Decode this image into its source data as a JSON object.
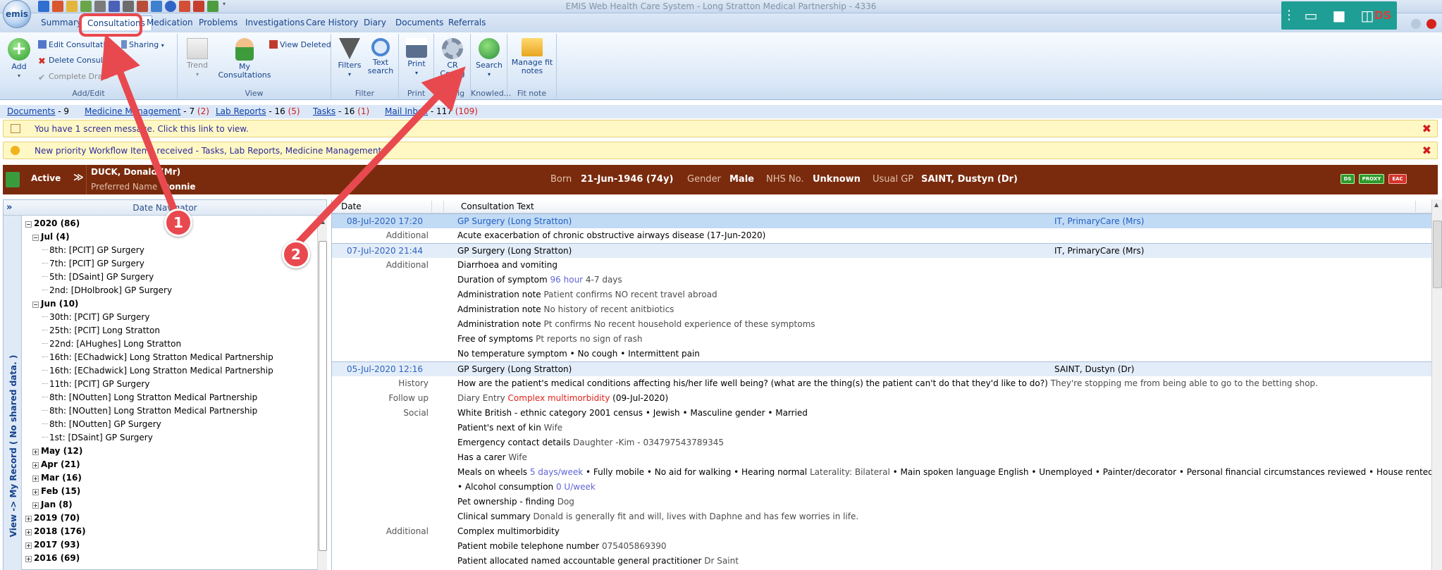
{
  "window": {
    "title": "EMIS Web Health Care System - Long Stratton Medical Partnership - 4336",
    "orb_label": "emis"
  },
  "tabs": [
    "Summary",
    "Consultations",
    "Medication",
    "Problems",
    "Investigations",
    "Care History",
    "Diary",
    "Documents",
    "Referrals"
  ],
  "active_tab": "Consultations",
  "teal_toolbar": {
    "initials": "DS"
  },
  "ribbon": {
    "add": "Add",
    "edit_consultation": "Edit Consultation",
    "sharing": "Sharing",
    "delete_consultation": "Delete Consultation",
    "complete_draft": "Complete Draft",
    "group_add_edit": "Add/Edit",
    "trend": "Trend",
    "my_consultations": "My Consultations",
    "view_deleted": "View Deleted",
    "group_view": "View",
    "filters": "Filters",
    "text_search": "Text search",
    "group_filter": "Filter",
    "print": "Print",
    "group_print": "Print",
    "cr_config": "CR Config",
    "group_config": "Config",
    "search": "Search",
    "group_knowledge": "Knowled...",
    "manage_fit_notes": "Manage fit notes",
    "group_fit_note": "Fit note"
  },
  "links": {
    "documents": "Documents",
    "documents_count": " - 9",
    "medicine": "Medicine Management",
    "medicine_count": " - 7 ",
    "medicine_red": "(2)",
    "lab": "Lab Reports",
    "lab_count": " - 16 ",
    "lab_red": "(5)",
    "tasks": "Tasks",
    "tasks_count": " - 16 ",
    "tasks_red": "(1)",
    "mail": "Mail Inbox",
    "mail_count": " - 117 ",
    "mail_red": "(109)"
  },
  "notifications": {
    "message": "You have 1 screen message. Click this link to view.",
    "priority": "New priority Workflow Items received - Tasks, Lab Reports, Medicine Management"
  },
  "patient": {
    "status": "Active",
    "name": "DUCK, Donald (Mr)",
    "preferred_label": "Preferred Name",
    "preferred_name": "Donnie",
    "born_label": "Born",
    "born": "21-Jun-1946 (74y)",
    "gender_label": "Gender",
    "gender": "Male",
    "nhs_label": "NHS No.",
    "nhs": "Unknown",
    "gp_label": "Usual GP",
    "gp": "SAINT, Dustyn (Dr)",
    "flags": [
      "DS",
      "PROXY",
      "EAC"
    ]
  },
  "navigator": {
    "header": "Date Navigator",
    "expand": "»",
    "vertical_text": "View -> My Record ( No shared data. )",
    "items": [
      {
        "text": "2020 (86)",
        "level": 0,
        "bold": true,
        "sign": "−"
      },
      {
        "text": "Jul (4)",
        "level": 1,
        "bold": true,
        "sign": "−"
      },
      {
        "text": "8th: [PCIT] GP Surgery",
        "level": 2
      },
      {
        "text": "7th: [PCIT] GP Surgery",
        "level": 2
      },
      {
        "text": "5th: [DSaint] GP Surgery",
        "level": 2
      },
      {
        "text": "2nd: [DHolbrook] GP Surgery",
        "level": 2
      },
      {
        "text": "Jun (10)",
        "level": 1,
        "bold": true,
        "sign": "−"
      },
      {
        "text": "30th: [PCIT] GP Surgery",
        "level": 2
      },
      {
        "text": "25th: [PCIT] Long Stratton",
        "level": 2
      },
      {
        "text": "22nd: [AHughes] Long Stratton",
        "level": 2
      },
      {
        "text": "16th: [EChadwick] Long Stratton Medical Partnership",
        "level": 2
      },
      {
        "text": "16th: [EChadwick] Long Stratton Medical Partnership",
        "level": 2
      },
      {
        "text": "11th: [PCIT] GP Surgery",
        "level": 2
      },
      {
        "text": "8th: [NOutten] Long Stratton Medical Partnership",
        "level": 2
      },
      {
        "text": "8th: [NOutten] Long Stratton Medical Partnership",
        "level": 2
      },
      {
        "text": "8th: [NOutten] GP Surgery",
        "level": 2
      },
      {
        "text": "1st: [DSaint] GP Surgery",
        "level": 2
      },
      {
        "text": "May (12)",
        "level": 1,
        "bold": true,
        "sign": "+"
      },
      {
        "text": "Apr (21)",
        "level": 1,
        "bold": true,
        "sign": "+"
      },
      {
        "text": "Mar (16)",
        "level": 1,
        "bold": true,
        "sign": "+"
      },
      {
        "text": "Feb (15)",
        "level": 1,
        "bold": true,
        "sign": "+"
      },
      {
        "text": "Jan (8)",
        "level": 1,
        "bold": true,
        "sign": "+"
      },
      {
        "text": "2019 (70)",
        "level": 0,
        "bold": true,
        "sign": "+"
      },
      {
        "text": "2018 (176)",
        "level": 0,
        "bold": true,
        "sign": "+"
      },
      {
        "text": "2017 (93)",
        "level": 0,
        "bold": true,
        "sign": "+"
      },
      {
        "text": "2016 (69)",
        "level": 0,
        "bold": true,
        "sign": "+"
      }
    ]
  },
  "grid": {
    "col_date": "Date",
    "col_text": "Consultation Text",
    "rows": [
      {
        "type": "header",
        "selected": true,
        "date": "08-Jul-2020 17:20",
        "text": "GP Surgery (Long Stratton)",
        "user": "IT, PrimaryCare (Mrs)"
      },
      {
        "type": "line",
        "label": "Additional",
        "parts": [
          {
            "t": "Acute exacerbation of chronic obstructive airways disease  (17-Jun-2020)"
          }
        ]
      },
      {
        "type": "header",
        "date": "07-Jul-2020 21:44",
        "text": "GP Surgery (Long Stratton)",
        "user": "IT, PrimaryCare (Mrs)"
      },
      {
        "type": "line",
        "label": "Additional",
        "parts": [
          {
            "t": "Diarrhoea and vomiting"
          }
        ]
      },
      {
        "type": "line",
        "parts": [
          {
            "t": "Duration of symptom "
          },
          {
            "t": "96 hour",
            "c": "blu"
          },
          {
            "t": " 4-7 days",
            "c": "gry"
          }
        ]
      },
      {
        "type": "line",
        "parts": [
          {
            "t": "Administration note "
          },
          {
            "t": "Patient confirms NO recent travel abroad",
            "c": "gry"
          }
        ]
      },
      {
        "type": "line",
        "parts": [
          {
            "t": "Administration note "
          },
          {
            "t": "No history of recent anitbiotics",
            "c": "gry"
          }
        ]
      },
      {
        "type": "line",
        "parts": [
          {
            "t": "Administration note "
          },
          {
            "t": "Pt confirms No recent household experience of these symptoms",
            "c": "gry"
          }
        ]
      },
      {
        "type": "line",
        "parts": [
          {
            "t": "Free of symptoms "
          },
          {
            "t": "Pt reports no sign of rash",
            "c": "gry"
          }
        ]
      },
      {
        "type": "line",
        "parts": [
          {
            "t": "No temperature symptom  • No cough  • Intermittent pain"
          }
        ]
      },
      {
        "type": "header",
        "date": "05-Jul-2020 12:16",
        "text": "GP Surgery (Long Stratton)",
        "user": "SAINT, Dustyn (Dr)"
      },
      {
        "type": "line",
        "label": "History",
        "parts": [
          {
            "t": "How are the patient's medical conditions affecting his/her life well being? (what are the thing(s) the patient can't do that they'd like to do?) "
          },
          {
            "t": "They're stopping me from being able to go to the betting shop.",
            "c": "gry"
          }
        ]
      },
      {
        "type": "line",
        "label": "Follow up",
        "parts": [
          {
            "t": "Diary Entry ",
            "c": "gry"
          },
          {
            "t": "Complex multimorbidity",
            "c": "rd"
          },
          {
            "t": "  (09-Jul-2020)"
          }
        ]
      },
      {
        "type": "line",
        "label": "Social",
        "parts": [
          {
            "t": "White British - ethnic category 2001 census  • Jewish  • Masculine gender  • Married"
          }
        ]
      },
      {
        "type": "line",
        "parts": [
          {
            "t": "Patient's next of kin "
          },
          {
            "t": "Wife",
            "c": "gry"
          }
        ]
      },
      {
        "type": "line",
        "parts": [
          {
            "t": "Emergency contact details "
          },
          {
            "t": "Daughter -Kim - 034797543789345",
            "c": "gry"
          }
        ]
      },
      {
        "type": "line",
        "parts": [
          {
            "t": "Has a carer "
          },
          {
            "t": "Wife",
            "c": "gry"
          }
        ]
      },
      {
        "type": "line",
        "parts": [
          {
            "t": "Meals on wheels "
          },
          {
            "t": "5 days/week",
            "c": "blu"
          },
          {
            "t": "  • Fully mobile  • No aid for walking  • Hearing normal "
          },
          {
            "t": "Laterality: Bilateral",
            "c": "gry"
          },
          {
            "t": "  • Main spoken language English  • Unemployed  • Painter/decorator  • Personal financial circumstances reviewed  • House rented from council"
          }
        ]
      },
      {
        "type": "cont",
        "parts": [
          {
            "t": " • Alcohol consumption  "
          },
          {
            "t": "0 U/week",
            "c": "blu"
          }
        ]
      },
      {
        "type": "line",
        "parts": [
          {
            "t": "Pet ownership - finding "
          },
          {
            "t": "Dog",
            "c": "gry"
          }
        ]
      },
      {
        "type": "line",
        "parts": [
          {
            "t": "Clinical summary "
          },
          {
            "t": "Donald is generally fit and will, lives with Daphne and has few worries in life.",
            "c": "gry"
          }
        ]
      },
      {
        "type": "line",
        "label": "Additional",
        "parts": [
          {
            "t": "Complex multimorbidity"
          }
        ]
      },
      {
        "type": "line",
        "parts": [
          {
            "t": "Patient mobile telephone number "
          },
          {
            "t": "075405869390",
            "c": "gry"
          }
        ]
      },
      {
        "type": "line",
        "parts": [
          {
            "t": "Patient allocated named accountable general practitioner "
          },
          {
            "t": "Dr Saint",
            "c": "gry"
          }
        ]
      }
    ]
  },
  "annotations": {
    "badge_1": "1",
    "badge_2": "2"
  },
  "colors": {
    "accent_red": "#e8494f",
    "banner_brown": "#7a2b0d",
    "teal": "#1f9e95",
    "link_blue": "#0b3fa8"
  }
}
